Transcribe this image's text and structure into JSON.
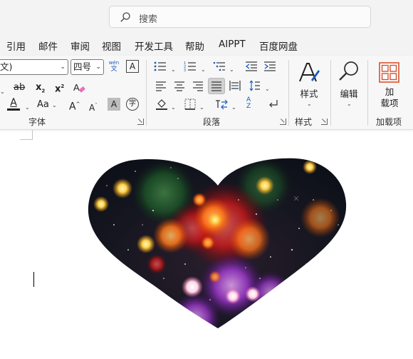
{
  "search": {
    "label": "搜索",
    "icon": "search-icon"
  },
  "tabs": [
    {
      "label": "引用",
      "active": false
    },
    {
      "label": "邮件",
      "active": true
    },
    {
      "label": "审阅",
      "active": false
    },
    {
      "label": "视图",
      "active": false
    },
    {
      "label": "开发工具",
      "active": false
    },
    {
      "label": "帮助",
      "active": false
    },
    {
      "label": "AIPPT",
      "active": false
    },
    {
      "label": "百度网盘",
      "active": false
    }
  ],
  "font": {
    "name_value": "文)",
    "size_value": "四号",
    "strikethrough": "ab",
    "subscript": "x",
    "subscript_mark": "2",
    "superscript": "x",
    "superscript_mark": "2",
    "case_label": "Aa",
    "grow_label": "A",
    "shrink_label": "A",
    "shade_label": "A",
    "phonetic_top": "wén",
    "phonetic_bottom": "文",
    "border_char": "A",
    "enclose_char": "字",
    "group_label": "字体"
  },
  "paragraph": {
    "group_label": "段落",
    "sort_a": "A",
    "sort_z": "Z"
  },
  "styles": {
    "button_label": "样式",
    "group_label": "样式"
  },
  "editing": {
    "button_label": "编辑"
  },
  "addins": {
    "button_line1": "加",
    "button_line2": "载项",
    "group_label": "加载项"
  },
  "colors": {
    "accent": "#185abd",
    "font_color_bar": "#c00000",
    "highlight_bar": "#ffff00",
    "addin_orange": "#d35230"
  }
}
